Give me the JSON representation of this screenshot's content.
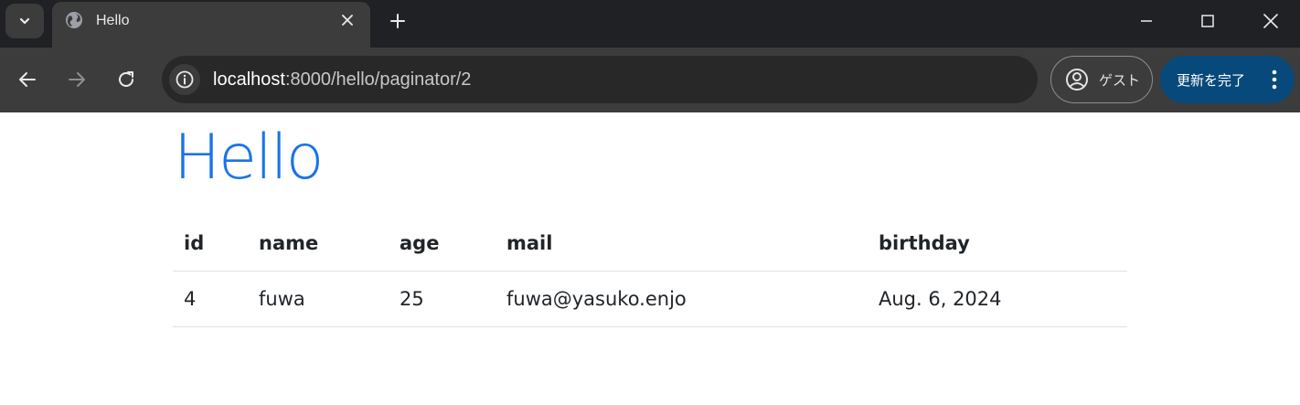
{
  "browser": {
    "tab": {
      "title": "Hello"
    },
    "address_bar": {
      "host": "localhost",
      "path": ":8000/hello/paginator/2"
    },
    "profile": {
      "label": "ゲスト"
    },
    "update": {
      "label": "更新を完了"
    },
    "colors": {
      "tab_bg": "#3c3c3c",
      "frame": "#202124",
      "update_bg": "#07497a"
    }
  },
  "page": {
    "title": "Hello",
    "table": {
      "headers": {
        "id": "id",
        "name": "name",
        "age": "age",
        "mail": "mail",
        "birthday": "birthday"
      },
      "rows": [
        {
          "id": "4",
          "name": "fuwa",
          "age": "25",
          "mail": "fuwa@yasuko.enjo",
          "birthday": "Aug. 6, 2024"
        }
      ]
    },
    "colors": {
      "title": "#1a73e8",
      "text": "#212529",
      "rule": "#dee2e6"
    }
  }
}
